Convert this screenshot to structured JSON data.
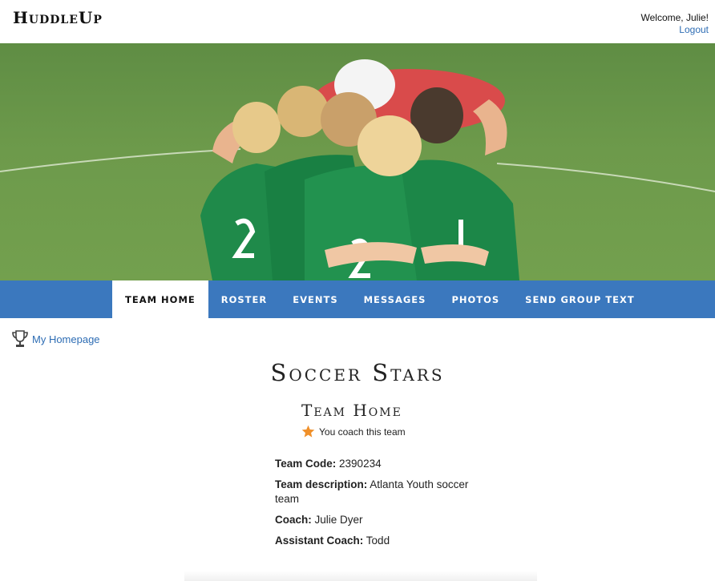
{
  "header": {
    "logo": "HuddleUp",
    "welcome": "Welcome, Julie!",
    "logout": "Logout"
  },
  "nav": {
    "tabs": [
      {
        "label": "Team Home",
        "active": true
      },
      {
        "label": "Roster"
      },
      {
        "label": "Events"
      },
      {
        "label": "Messages"
      },
      {
        "label": "Photos"
      },
      {
        "label": "Send Group Text"
      }
    ]
  },
  "sidebar": {
    "homepage_link": "My Homepage",
    "homepage_icon": "trophy-icon"
  },
  "team": {
    "name": "Soccer Stars",
    "section_title": "Team Home",
    "coach_note": "You coach this team",
    "coach_icon": "star-icon",
    "details": [
      {
        "label": "Team Code:",
        "value": "2390234"
      },
      {
        "label": "Team description:",
        "value": "Atlanta Youth soccer team"
      },
      {
        "label": "Coach:",
        "value": "Julie Dyer"
      },
      {
        "label": "Assistant Coach:",
        "value": "Todd"
      }
    ]
  },
  "colors": {
    "nav_bg": "#3b78be",
    "link": "#2e6db4",
    "star": "#f0902a",
    "jersey": "#1f8a4a"
  }
}
